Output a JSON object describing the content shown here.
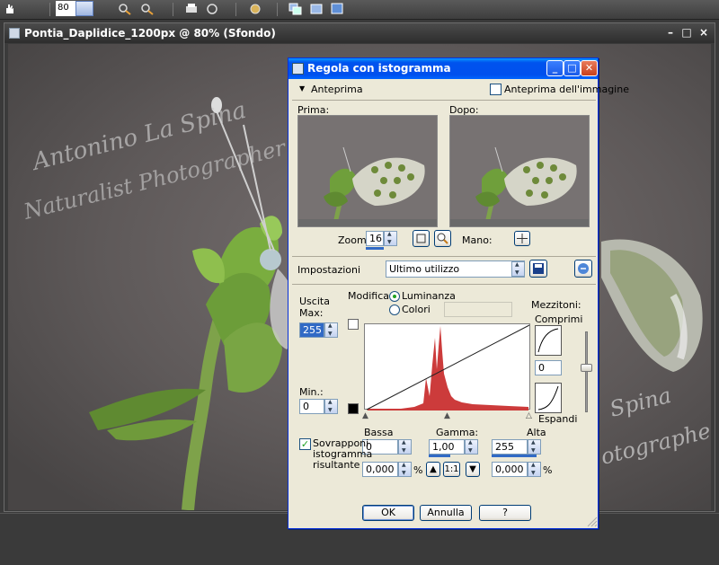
{
  "toolbar": {
    "zoom_value": "80"
  },
  "document": {
    "title": "Pontia_Daplidice_1200px @  80% (Sfondo)",
    "watermark_line1": "Antonino La Spina",
    "watermark_line2": "Naturalist Photographer",
    "watermark_right1": "Spina",
    "watermark_right2": "otographer"
  },
  "dialog": {
    "title": "Regola con istogramma",
    "preview_toggle": "Anteprima",
    "preview_image_label": "Anteprima dell'immagine",
    "before_label": "Prima:",
    "after_label": "Dopo:",
    "zoom_label": "Zoom:",
    "zoom_value": "16",
    "pan_label": "Mano:",
    "settings_label": "Impostazioni",
    "settings_value": "Ultimo utilizzo",
    "modify_label": "Modifica:",
    "luminance_label": "Luminanza",
    "colors_label": "Colori",
    "output_label": "Uscita\nMax:",
    "output_max": "255",
    "output_min_label": "Min.:",
    "output_min": "0",
    "midtones_label": "Mezzitoni:",
    "compress_label": "Comprimi",
    "midtone_value": "0",
    "expand_label": "Espandi",
    "low_label": "Bassa",
    "gamma_label": "Gamma:",
    "high_label": "Alta",
    "low_value": "0",
    "gamma_value": "1,00",
    "high_value": "255",
    "low_pct": "0,000",
    "high_pct": "0,000",
    "pct_symbol": "%",
    "ratio_label": "1:1",
    "overlay_label": "Sovrapponi istogramma risultante",
    "ok_label": "OK",
    "cancel_label": "Annulla",
    "help_label": "?"
  },
  "colors": {
    "histogram_fill": "#cc3b3b",
    "titlebar_blue": "#0053ee"
  }
}
